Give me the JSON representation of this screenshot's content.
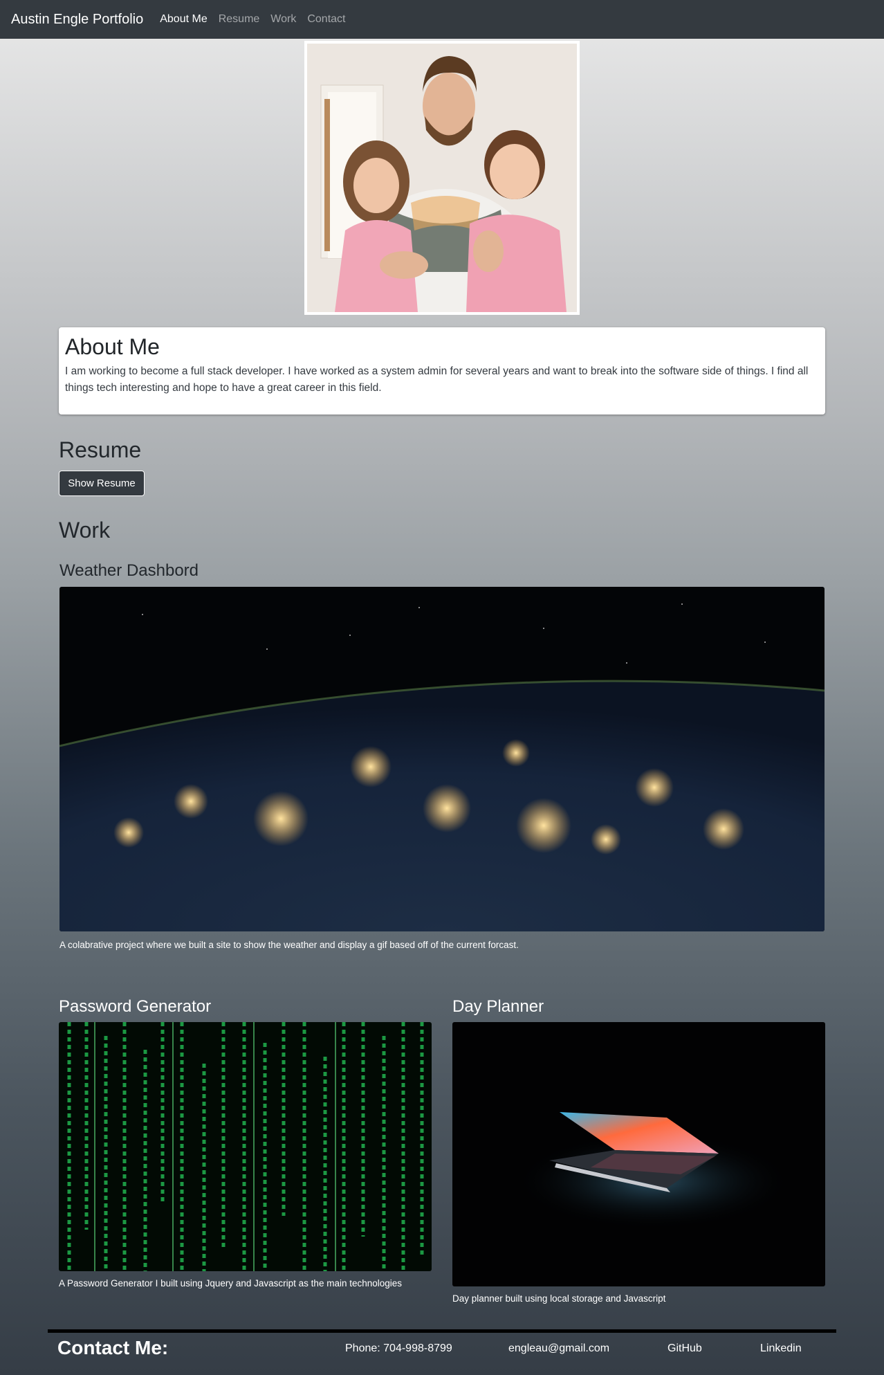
{
  "navbar": {
    "brand": "Austin Engle Portfolio",
    "links": [
      "About Me",
      "Resume",
      "Work",
      "Contact"
    ],
    "active": "About Me"
  },
  "about": {
    "title": "About Me",
    "text": "I am working to become a full stack developer. I have worked as a system admin for several years and want to break into the software side of things. I find all things tech interesting and hope to have a great career in this field."
  },
  "resume": {
    "title": "Resume",
    "button_label": "Show Resume"
  },
  "work": {
    "title": "Work",
    "projects": [
      {
        "title": "Weather Dashbord",
        "caption": "A colabrative project where we built a site to show the weather and display a gif based off of the current forcast."
      },
      {
        "title": "Password Generator",
        "caption": "A Password Generator I built using Jquery and Javascript as the main technologies"
      },
      {
        "title": "Day Planner",
        "caption": "Day planner built using local storage and Javascript"
      }
    ]
  },
  "contact": {
    "title": "Contact Me:",
    "phone": "Phone: 704-998-8799",
    "email": "engleau@gmail.com",
    "github": "GitHub",
    "linkedin": "Linkedin"
  },
  "colors": {
    "navbar": "#343a40",
    "card": "#ffffff",
    "button": "#343a40"
  }
}
